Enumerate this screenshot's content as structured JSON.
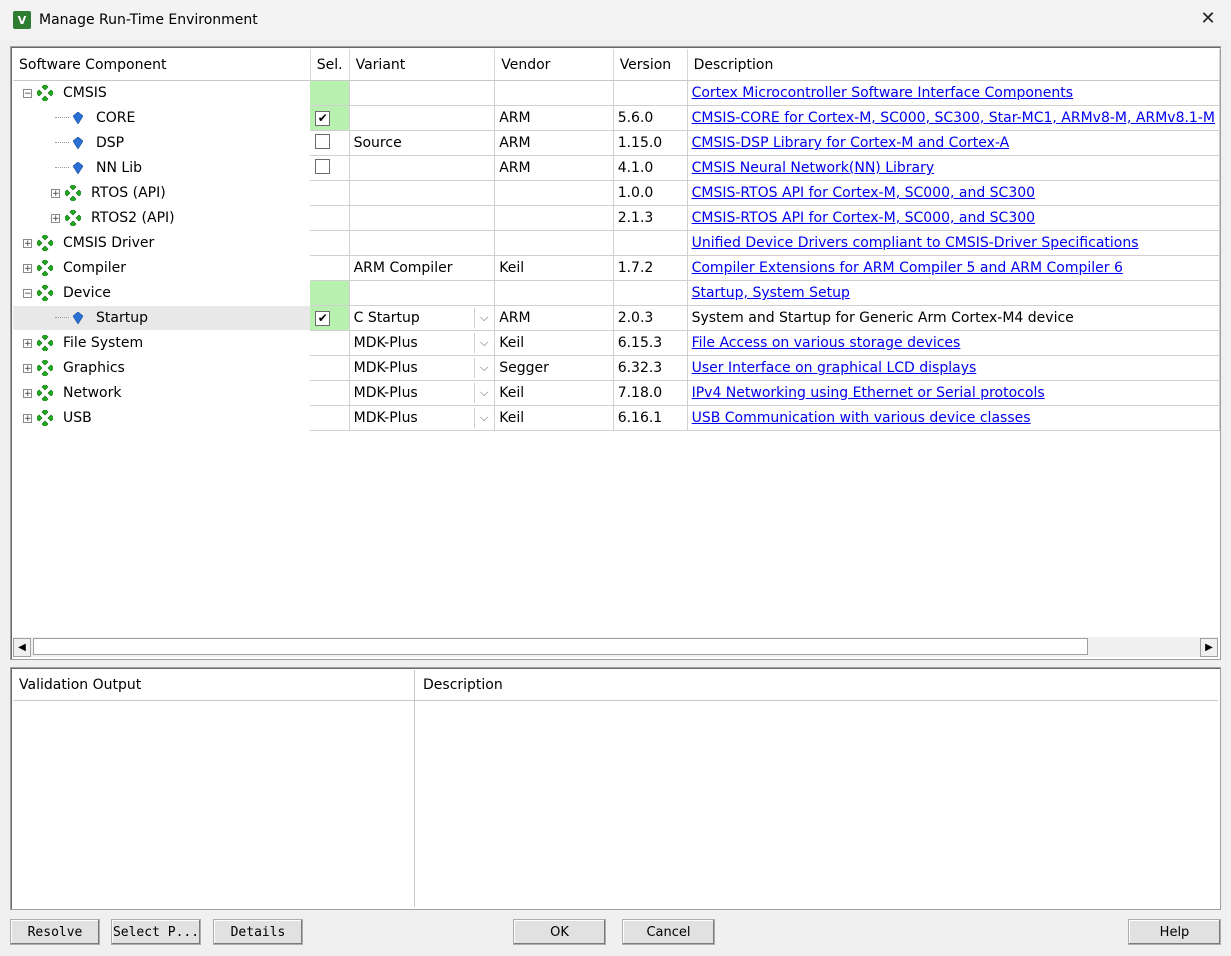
{
  "window": {
    "title": "Manage Run-Time Environment",
    "close_glyph": "✕",
    "icon_label": "V"
  },
  "columns": [
    "Software Component",
    "Sel.",
    "Variant",
    "Vendor",
    "Version",
    "Description"
  ],
  "rows": [
    {
      "name": "CMSIS",
      "level": 0,
      "kind": "pkg",
      "expander": "⊟",
      "sel": "",
      "sel_green": true,
      "variant": "",
      "vendor": "",
      "version": "",
      "description": "Cortex Microcontroller Software Interface Components",
      "link": true
    },
    {
      "name": "CORE",
      "level": 1,
      "kind": "comp",
      "sel": "✔",
      "sel_green": true,
      "variant": "",
      "vendor": "ARM",
      "version": "5.6.0",
      "description": "CMSIS-CORE for Cortex-M, SC000, SC300, Star-MC1, ARMv8-M, ARMv8.1-M",
      "link": true
    },
    {
      "name": "DSP",
      "level": 1,
      "kind": "comp",
      "sel": "",
      "checkbox": true,
      "variant": "Source",
      "vendor": "ARM",
      "version": "1.15.0",
      "description": "CMSIS-DSP Library for Cortex-M and Cortex-A",
      "link": true
    },
    {
      "name": "NN Lib",
      "level": 1,
      "kind": "comp",
      "sel": "",
      "checkbox": true,
      "variant": "",
      "vendor": "ARM",
      "version": "4.1.0",
      "description": "CMSIS Neural Network(NN) Library",
      "link": true
    },
    {
      "name": "RTOS (API)",
      "level": 1,
      "kind": "pkg",
      "expander": "⊞",
      "variant": "",
      "vendor": "",
      "version": "1.0.0",
      "description": "CMSIS-RTOS API for Cortex-M, SC000, and SC300",
      "link": true
    },
    {
      "name": "RTOS2 (API)",
      "level": 1,
      "kind": "pkg",
      "expander": "⊞",
      "variant": "",
      "vendor": "",
      "version": "2.1.3",
      "description": "CMSIS-RTOS API for Cortex-M, SC000, and SC300",
      "link": true
    },
    {
      "name": "CMSIS Driver",
      "level": 0,
      "kind": "pkg",
      "expander": "⊞",
      "variant": "",
      "vendor": "",
      "version": "",
      "description": "Unified Device Drivers compliant to CMSIS-Driver Specifications",
      "link": true
    },
    {
      "name": "Compiler",
      "level": 0,
      "kind": "pkg",
      "expander": "⊞",
      "variant": "ARM Compiler",
      "vendor": "Keil",
      "version": "1.7.2",
      "description": "Compiler Extensions for ARM Compiler 5 and ARM Compiler 6",
      "link": true
    },
    {
      "name": "Device",
      "level": 0,
      "kind": "pkg",
      "expander": "⊟",
      "sel_green": true,
      "variant": "",
      "vendor": "",
      "version": "",
      "description": "Startup, System Setup",
      "link": true
    },
    {
      "name": "Startup",
      "level": 1,
      "kind": "comp",
      "highlight": true,
      "sel": "✔",
      "sel_green": true,
      "variant": "C Startup",
      "combo": true,
      "vendor": "ARM",
      "version": "2.0.3",
      "description": "System and Startup for Generic Arm Cortex-M4 device",
      "link": false
    },
    {
      "name": "File System",
      "level": 0,
      "kind": "pkg",
      "expander": "⊞",
      "variant": "MDK-Plus",
      "combo": true,
      "vendor": "Keil",
      "version": "6.15.3",
      "description": "File Access on various storage devices",
      "link": true
    },
    {
      "name": "Graphics",
      "level": 0,
      "kind": "pkg",
      "expander": "⊞",
      "variant": "MDK-Plus",
      "combo": true,
      "vendor": "Segger",
      "version": "6.32.3",
      "description": "User Interface on graphical LCD displays",
      "link": true
    },
    {
      "name": "Network",
      "level": 0,
      "kind": "pkg",
      "expander": "⊞",
      "variant": "MDK-Plus",
      "combo": true,
      "vendor": "Keil",
      "version": "7.18.0",
      "description": "IPv4 Networking using Ethernet or Serial protocols",
      "link": true
    },
    {
      "name": "USB",
      "level": 0,
      "kind": "pkg",
      "expander": "⊞",
      "variant": "MDK-Plus",
      "combo": true,
      "vendor": "Keil",
      "version": "6.16.1",
      "description": "USB Communication with various device classes",
      "link": true
    }
  ],
  "validation": {
    "col1": "Validation Output",
    "col2": "Description"
  },
  "scroll": {
    "left": "◀",
    "right": "▶"
  },
  "combo_glyph": "⌵",
  "buttons": {
    "resolve": "Resolve",
    "select_packs": "Select P...",
    "details": "Details",
    "ok": "OK",
    "cancel": "Cancel",
    "help": "Help"
  },
  "colors": {
    "sel_green": "#b8f0b0",
    "link": "#0000ee",
    "pkg_icon": "#1faa1f",
    "comp_icon": "#2a6fd6"
  }
}
